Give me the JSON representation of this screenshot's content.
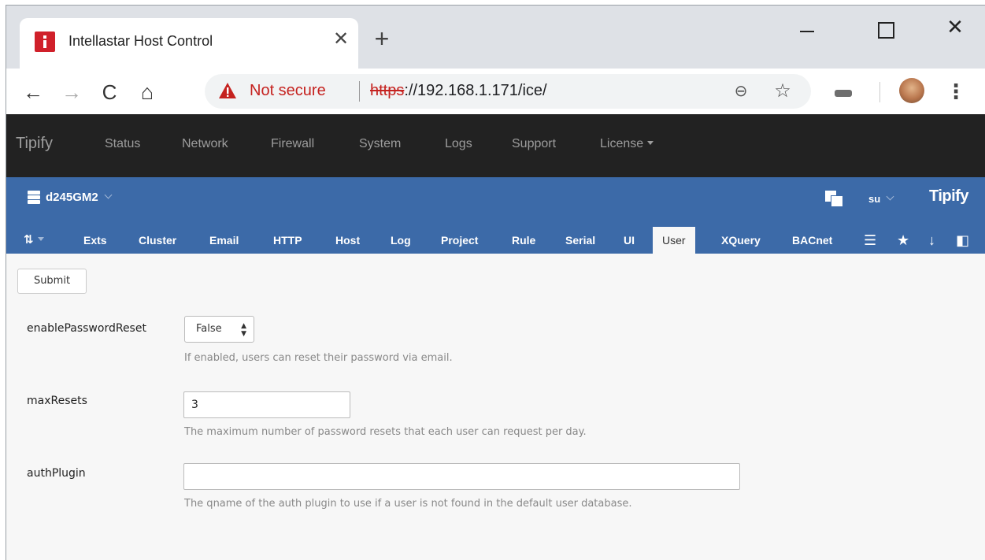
{
  "browser": {
    "tab_title": "Intellastar Host Control",
    "tab_close_glyph": "✕",
    "new_tab_glyph": "+",
    "window_close_glyph": "✕",
    "security_label": "Not secure",
    "url_scheme": "https",
    "url_rest": "://192.168.1.171/ice/",
    "icons": {
      "back": "←",
      "forward": "→",
      "reload": "C",
      "home": "⌂",
      "zoom": "⊖",
      "star": "☆",
      "menu": "⋮"
    }
  },
  "appnav": {
    "brand": "Tipify",
    "links": [
      "Status",
      "Network",
      "Firewall",
      "System",
      "Logs",
      "Support"
    ],
    "license_label": "License"
  },
  "header": {
    "project": "d245GM2",
    "user": "su",
    "logo": "Tipify"
  },
  "subtabs": {
    "tune_glyph": "⇅",
    "items": [
      "Exts",
      "Cluster",
      "Email",
      "HTTP",
      "Host",
      "Log",
      "Project",
      "Rule",
      "Serial",
      "UI",
      "User",
      "XQuery",
      "BACnet"
    ],
    "active": "User",
    "util_icons": [
      "☰",
      "★",
      "↓",
      "◧"
    ]
  },
  "form": {
    "submit_label": "Submit",
    "fields": [
      {
        "name": "enablePasswordReset",
        "type": "select",
        "value": "False",
        "help": "If enabled, users can reset their password via email."
      },
      {
        "name": "maxResets",
        "type": "text",
        "value": "3",
        "help": "The maximum number of password resets that each user can request per day."
      },
      {
        "name": "authPlugin",
        "type": "text",
        "value": "",
        "help": "The qname of the auth plugin to use if a user is not found in the default user database."
      }
    ]
  },
  "colors": {
    "navbar": "#222222",
    "header_blue": "#3c6aa8",
    "insecure_red": "#c5221f"
  }
}
